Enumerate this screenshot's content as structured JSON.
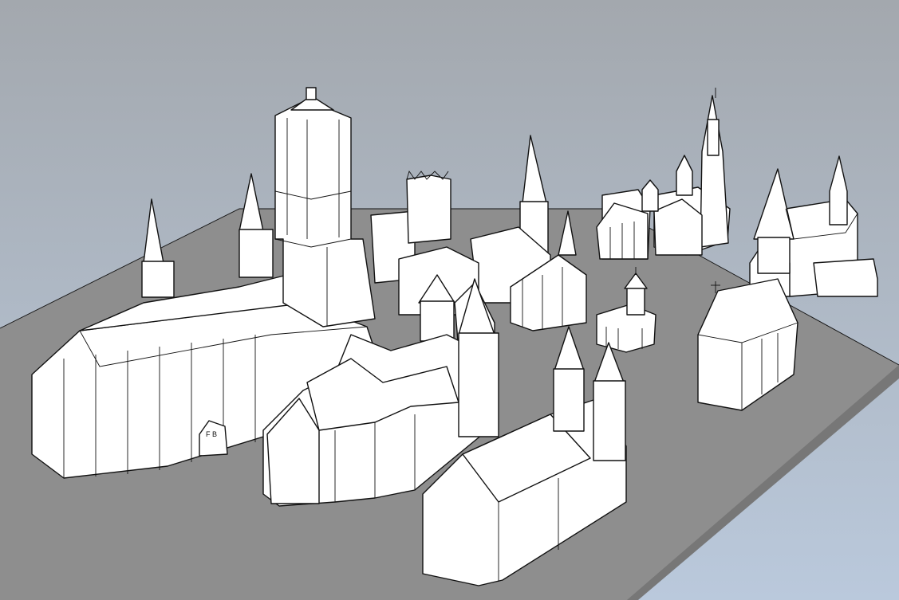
{
  "scene": {
    "colors": {
      "sky_top": "#a3a8ae",
      "sky_bottom": "#bac9dc",
      "ground_top": "#8e8e8e",
      "ground_side": "#777777",
      "building_light": "#ffffff",
      "building_shade": "#eeeeee",
      "outline": "#111111"
    },
    "buildings": [
      "big-cathedral",
      "crossing-tower",
      "west-front-church",
      "tall-spire-church",
      "domed-chapel",
      "twin-tower-church",
      "cupola-pavilion",
      "town-church",
      "apse-chapel",
      "belfry-church",
      "east-church",
      "small-church"
    ],
    "signage": {
      "door_letters": "F B"
    }
  }
}
